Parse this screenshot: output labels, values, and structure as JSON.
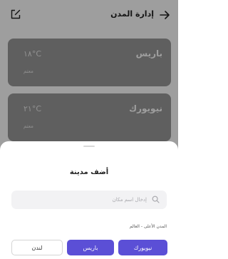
{
  "header": {
    "title": "إدارة المدن",
    "back_icon": "arrow-right-icon",
    "edit_icon": "edit-icon"
  },
  "cities": [
    {
      "name": "باريس",
      "temp": "١٨°C",
      "condition": "معتم"
    },
    {
      "name": "نيويورك",
      "temp": "٢١°C",
      "condition": "معتم"
    }
  ],
  "sheet": {
    "title": "أضف مدينة",
    "search_placeholder": "إدخال اسم مكان",
    "search_value": "",
    "search_icon": "search-icon",
    "section_label": "المدن الأعلى - العالم",
    "popular": [
      "نيويورك",
      "باريس",
      "لندن"
    ]
  },
  "colors": {
    "accent": "#5b4fd6",
    "card_bg": "#9a9a9a",
    "overlay": "rgba(0,0,0,0.38)"
  }
}
